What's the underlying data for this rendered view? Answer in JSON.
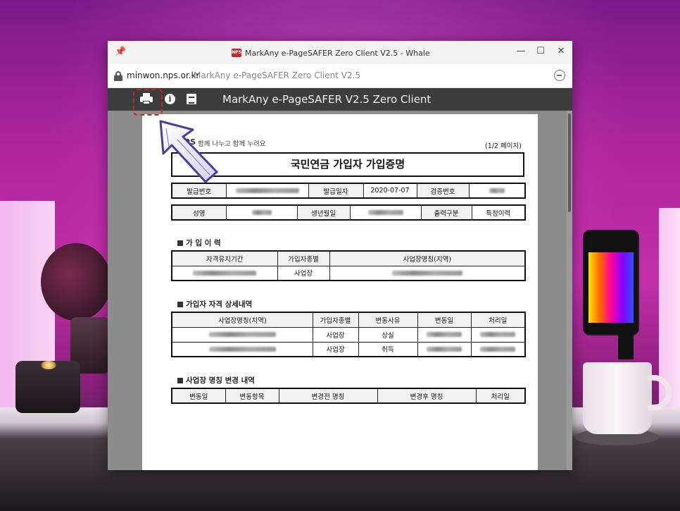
{
  "window": {
    "title": "MarkAny e-PageSAFER Zero Client V2.5 - Whale",
    "app_icon_text": "NPS",
    "controls": {
      "minimize": "—",
      "maximize": "☐",
      "close": "✕"
    }
  },
  "address_bar": {
    "domain": "minwon.nps.or.kr",
    "page_title": "MarkAny e-PageSAFER Zero Client V2.5"
  },
  "viewer": {
    "title": "MarkAny e-PageSAFER V2.5 Zero Client",
    "toolbar_icons": [
      "print-icon",
      "info-icon",
      "document-icon"
    ]
  },
  "document": {
    "logo": "NPS",
    "slogan": "함께 나누고 함께 누려요",
    "page_count": "(1/2 페이지)",
    "title": "국민연금 가입자 가입증명",
    "info_row1": {
      "issue_no_label": "발급번호",
      "issue_date_label": "발급일자",
      "issue_date": "2020-07-07",
      "verify_no_label": "검증번호"
    },
    "info_row2": {
      "name_label": "성명",
      "birth_label": "생년월일",
      "output_type_label": "출력구분",
      "output_type": "특정이력"
    },
    "section1": {
      "title": "가 입 이 력",
      "headers": [
        "자격유지기간",
        "가입자종별",
        "사업장명칭(지역)"
      ],
      "row": {
        "type": "사업장"
      }
    },
    "section2": {
      "title": "가입자 자격 상세내역",
      "headers": [
        "사업장명칭(지역)",
        "가입자종별",
        "변동사유",
        "변동일",
        "처리일"
      ],
      "rows": [
        {
          "type": "사업장",
          "reason": "상실"
        },
        {
          "type": "사업장",
          "reason": "취득"
        }
      ]
    },
    "section3": {
      "title": "사업장 명칭 변경 내역",
      "headers": [
        "변동일",
        "변동항목",
        "변경전 명칭",
        "변경후 명칭",
        "처리일"
      ]
    }
  },
  "colors": {
    "viewer_toolbar": "#3d3d3d",
    "viewer_background": "#8c8c8c",
    "highlight": "#d02020",
    "arrow": "#4a3fa0"
  }
}
